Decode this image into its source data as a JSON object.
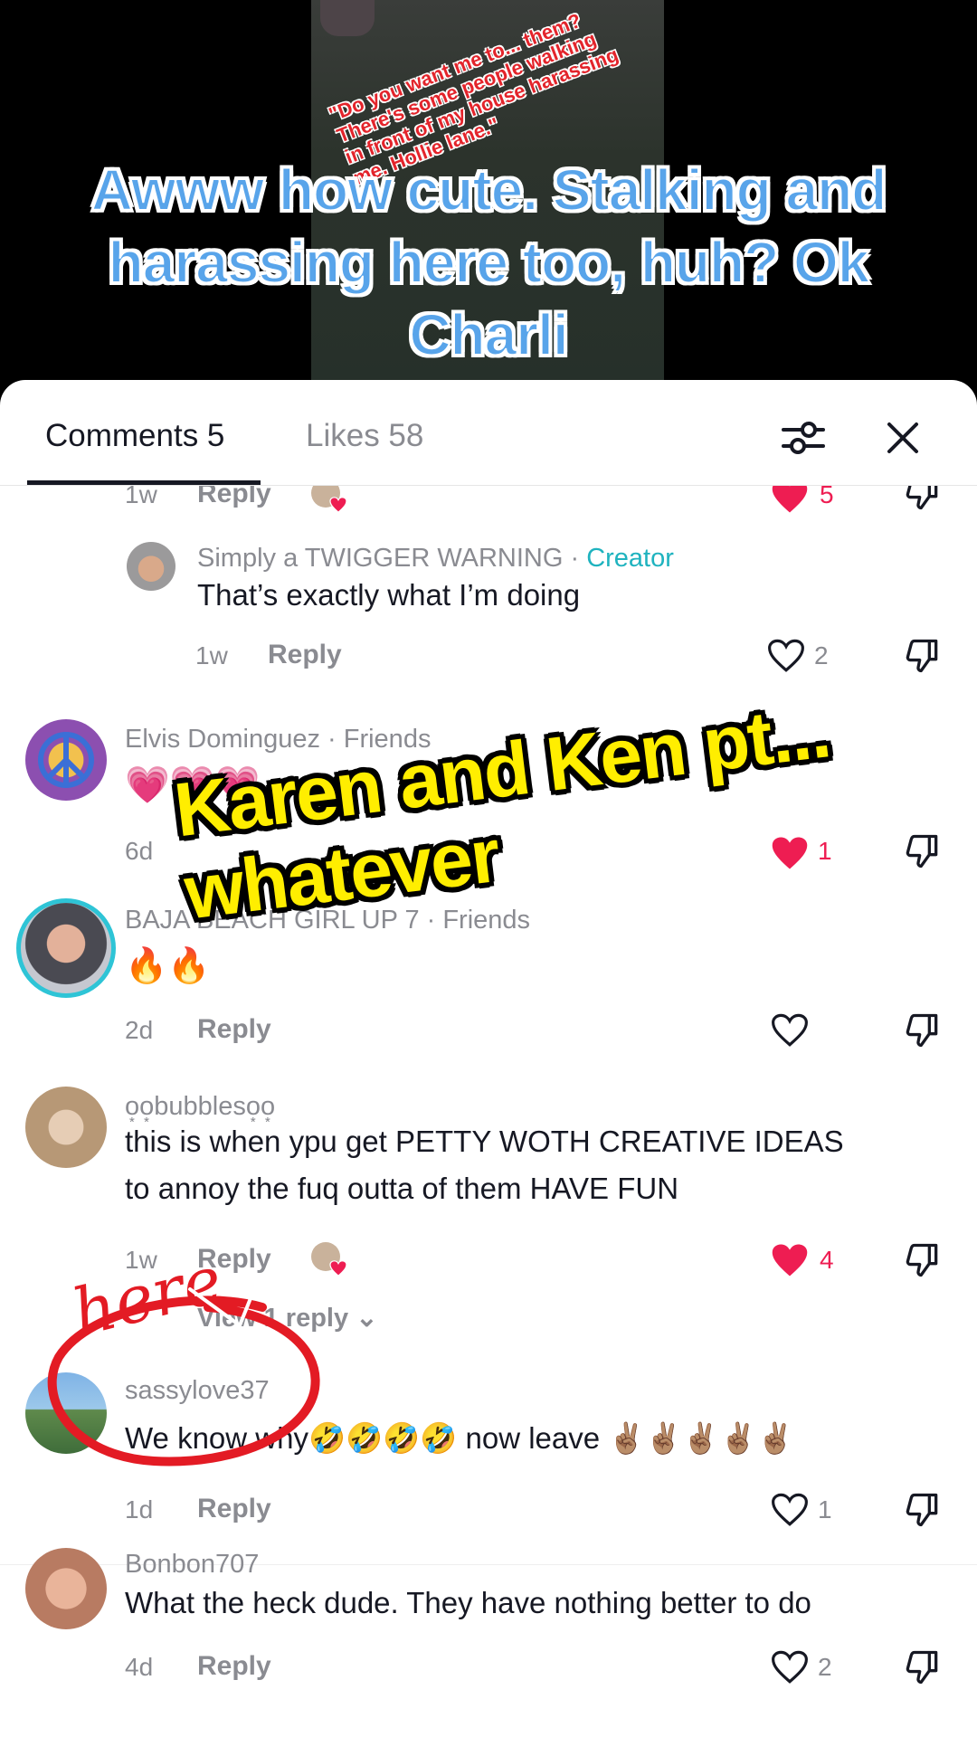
{
  "video": {
    "overlay_text": "\"Do you want me to... them? There's some people walking in front of my house harassing me. Hollie lane.\"",
    "caption": "Awww how cute. Stalking and harassing here too, huh? Ok Charli"
  },
  "sheet": {
    "tabs": [
      {
        "label": "Comments 5"
      },
      {
        "label": "Likes 58"
      }
    ],
    "filter_icon": "sliders-icon",
    "close_icon": "close-icon"
  },
  "comments": [
    {
      "time": "1w",
      "reply": "Reply",
      "likes": "5",
      "liked": true,
      "creator_liked": true
    },
    {
      "user": "Simply a TWIGGER WARNING · ",
      "badge": "Creator",
      "text": "That’s exactly what I’m doing",
      "time": "1w",
      "reply": "Reply",
      "likes": "2",
      "liked": false
    },
    {
      "user": "Elvis Dominguez · Friends",
      "text": "💗💗💗",
      "time": "6d",
      "reply": "Reply",
      "likes": "1",
      "liked": true
    },
    {
      "user": "BAJA BEACH GIRL UP 7 · Friends",
      "text": "🔥🔥",
      "time": "2d",
      "reply": "Reply",
      "likes": "",
      "liked": false
    },
    {
      "user": "o͙o͙bubbleso͙o͙",
      "text": "this is when ypu get PETTY WOTH CREATIVE IDEAS",
      "text2": "to annoy the fuq outta of them HAVE FUN",
      "time": "1w",
      "reply": "Reply",
      "likes": "4",
      "liked": true,
      "creator_liked": true,
      "view_replies": "View 1 reply"
    },
    {
      "user": "sassylove37",
      "text": "We know why🤣🤣🤣🤣 now leave ✌🏽✌🏽✌🏽✌🏽✌🏽",
      "time": "1d",
      "reply": "Reply",
      "likes": "1",
      "liked": false
    },
    {
      "user": "Bonbon707",
      "text": "What the heck dude. They have nothing better to do",
      "time": "4d",
      "reply": "Reply",
      "likes": "2",
      "liked": false
    }
  ],
  "stickers": {
    "karen": "Karen and Ken pt...",
    "karen2": "whatever",
    "here": "here"
  },
  "colors": {
    "heart_liked": "#ee1d52",
    "creator_badge": "#1fb3bf",
    "caption_fill": "#58a4ea",
    "sticker_yellow": "#ffee00",
    "annotation_red": "#e31b24"
  }
}
